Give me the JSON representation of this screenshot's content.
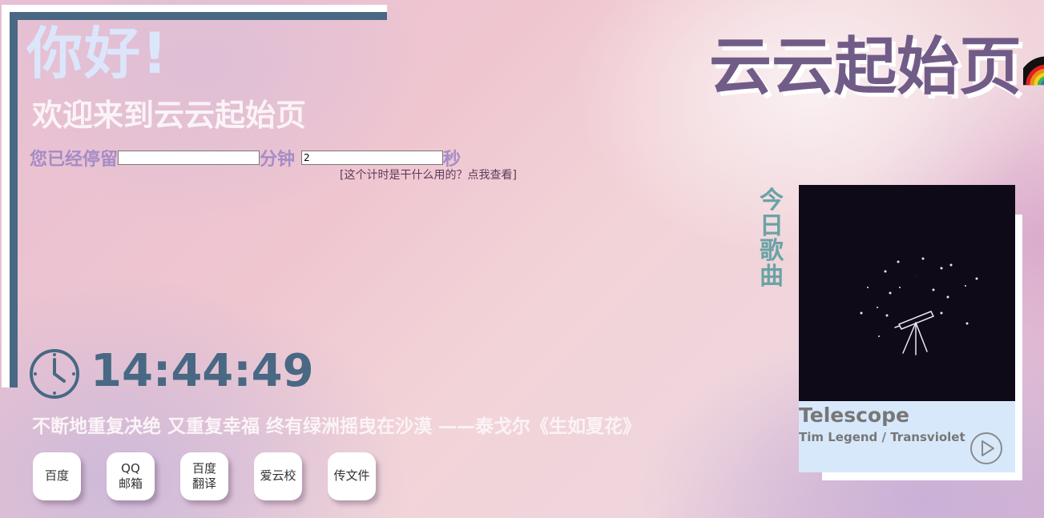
{
  "greeting": {
    "hello": "你好!",
    "welcome": "欢迎来到云云起始页",
    "stay_prefix": "您已经停留",
    "minute_unit": "分钟",
    "second_unit": "秒",
    "minutes_value": "",
    "seconds_value": "2",
    "timer_help_link": "[这个计时是干什么用的？点我查看]"
  },
  "clock": {
    "time": "14:44:49",
    "icon": "clock-icon"
  },
  "quote": "不断地重复决绝 又重复幸福 终有绿洲摇曳在沙漠 ——泰戈尔《生如夏花》",
  "links": [
    {
      "label": "百度"
    },
    {
      "label": "QQ\n邮箱"
    },
    {
      "label": "百度\n翻译"
    },
    {
      "label": "爱云校"
    },
    {
      "label": "传文件"
    }
  ],
  "site": {
    "title": "云云起始页",
    "icon": "rainbow-icon"
  },
  "music": {
    "section_label_chars": [
      "今",
      "日",
      "歌",
      "曲"
    ],
    "song_title": "Telescope",
    "song_artist": "Tim Legend / Transviolet",
    "play_icon": "play-icon"
  },
  "colors": {
    "frame": "#486883",
    "hello": "#dbe6fb",
    "accent_purple": "#a48cc6",
    "site_title": "#715c88",
    "music_label": "#6aa3a6",
    "music_card": "#d8e8fb"
  }
}
